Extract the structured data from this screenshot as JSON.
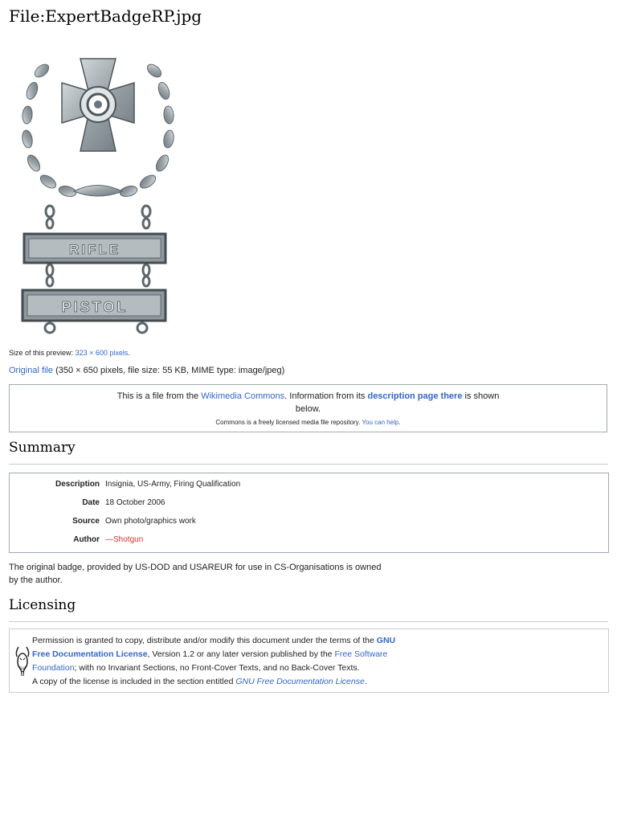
{
  "page": {
    "title": "File:ExpertBadgeRP.jpg"
  },
  "image": {
    "bar1_text": "RIFLE",
    "bar2_text": "PISTOL"
  },
  "preview": {
    "label": "Size of this preview:",
    "size_link": "323 × 600 pixels",
    "end": "."
  },
  "original": {
    "link": "Original file",
    "info": "(350 × 650 pixels, file size: 55 KB, MIME type: image/jpeg)"
  },
  "commons": {
    "text1": "This is a file from the ",
    "commons_link": "Wikimedia Commons",
    "text2": ". Information from its ",
    "desc_link": "description page there",
    "text3": " is shown below.",
    "note": "Commons is a freely licensed media file repository. ",
    "help_link": "You can help",
    "note_end": "."
  },
  "summary": {
    "heading": "Summary",
    "rows": [
      {
        "label": "Description",
        "value": "Insignia, US-Army, Firing Qualification"
      },
      {
        "label": "Date",
        "value": "18 October 2006"
      },
      {
        "label": "Source",
        "value": "Own photo/graphics work"
      },
      {
        "label": "Author",
        "value": "—Shotgun"
      }
    ],
    "note": "The original badge, provided by US-DOD and USAREUR for use in CS-Organisations is owned by the author."
  },
  "licensing": {
    "heading": "Licensing",
    "t1": "Permission is granted to copy, distribute and/or modify this document under the terms of the ",
    "gfdl_link": "GNU Free Documentation License",
    "t2": ", Version 1.2 or any later version published by the ",
    "fsf_link": "Free Software Foundation",
    "t3": "; with no Invariant Sections, no Front-Cover Texts, and no Back-Cover Texts.",
    "t4": "A copy of the license is included in the section entitled ",
    "gfdl_link2": "GNU Free Documentation License",
    "t5": "."
  },
  "colors": {
    "link": "#3366cc",
    "redlink": "#dd3333",
    "border": "#a2a9b1"
  }
}
